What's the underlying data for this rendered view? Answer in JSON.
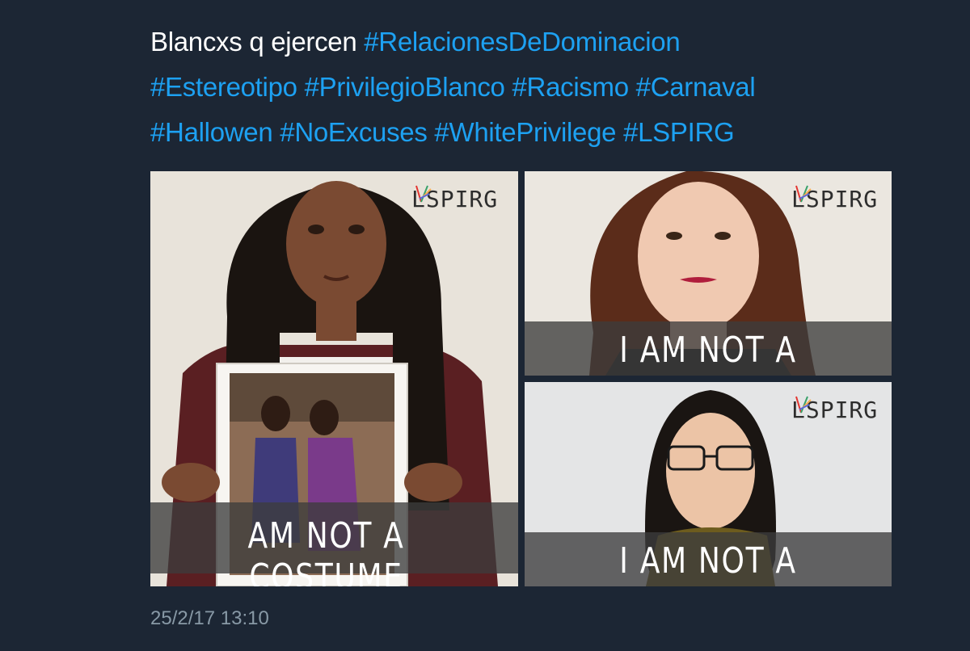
{
  "tweet": {
    "text_prefix": "Blancxs q ejercen ",
    "hashtags": [
      "#RelacionesDeDominacion",
      "#Estereotipo",
      "#PrivilegioBlanco",
      "#Racismo",
      "#Carnaval",
      "#Hallowen",
      "#NoExcuses",
      "#WhitePrivilege",
      "#LSPIRG"
    ],
    "timestamp": "25/2/17 13:10"
  },
  "media": {
    "left": {
      "logo": "LSPIRG",
      "caption": "AM NOT A COSTUME"
    },
    "top_right": {
      "logo": "LSPIRG",
      "caption": "I AM NOT A COSTUME"
    },
    "bottom_right": {
      "logo": "LSPIRG",
      "caption": "I AM NOT A COSTUME"
    }
  },
  "colors": {
    "background": "#1c2634",
    "hashtag": "#1da1f2",
    "text": "#ffffff",
    "timestamp": "#8899a6"
  }
}
